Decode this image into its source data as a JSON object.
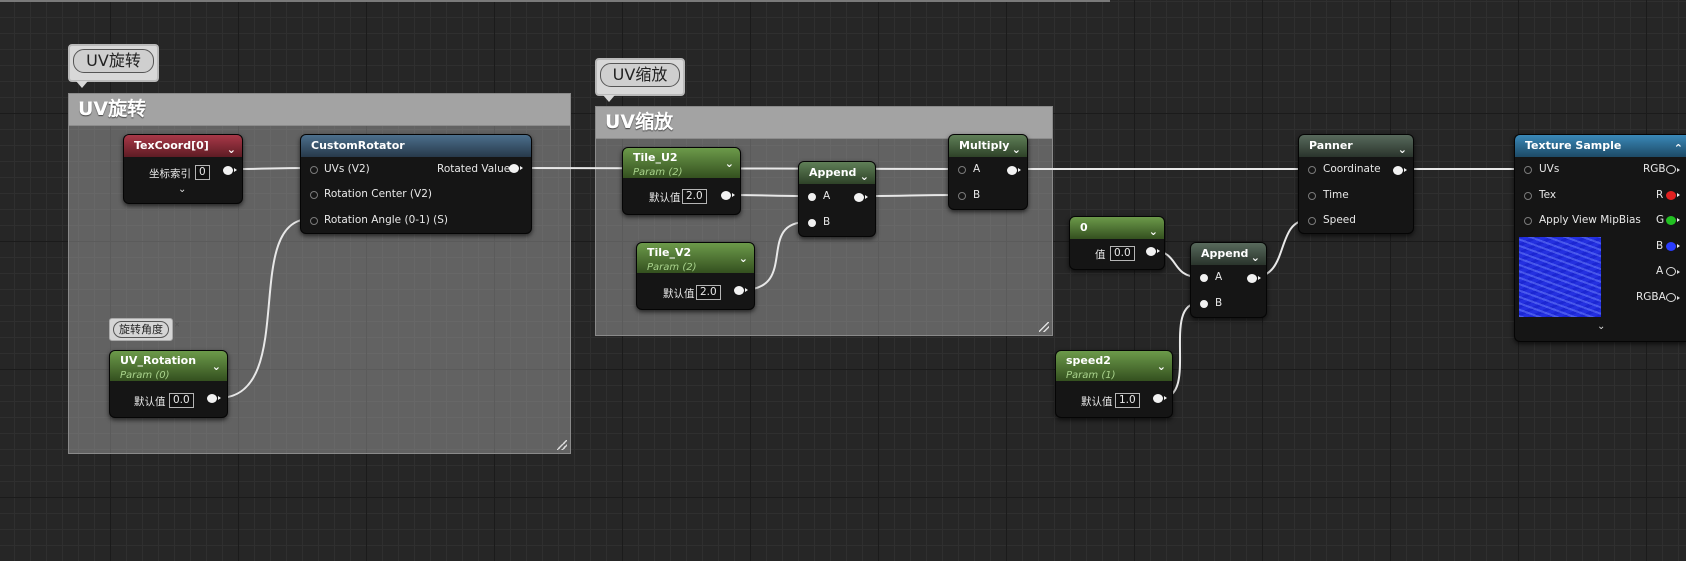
{
  "comments": {
    "rotate": {
      "title": "UV旋转",
      "bubble": "UV旋转"
    },
    "scale": {
      "title": "UV缩放",
      "bubble": "UV缩放"
    }
  },
  "nodes": {
    "texcoord": {
      "title": "TexCoord[0]",
      "row_label": "坐标索引",
      "value": "0"
    },
    "custom_rotator": {
      "title": "CustomRotator",
      "inputs": [
        "UVs (V2)",
        "Rotation Center (V2)",
        "Rotation Angle (0-1) (S)"
      ],
      "output": "Rotated Values"
    },
    "uv_rotation": {
      "title": "UV_Rotation",
      "subtitle": "Param (0)",
      "row_label": "默认值",
      "value": "0.0",
      "bubble": "旋转角度"
    },
    "tile_u2": {
      "title": "Tile_U2",
      "subtitle": "Param (2)",
      "row_label": "默认值",
      "value": "2.0"
    },
    "tile_v2": {
      "title": "Tile_V2",
      "subtitle": "Param (2)",
      "row_label": "默认值",
      "value": "2.0"
    },
    "append1": {
      "title": "Append",
      "inputs": [
        "A",
        "B"
      ]
    },
    "multiply": {
      "title": "Multiply",
      "inputs": [
        "A",
        "B"
      ]
    },
    "const0": {
      "title": "0",
      "row_label": "值",
      "value": "0.0"
    },
    "append2": {
      "title": "Append",
      "inputs": [
        "A",
        "B"
      ]
    },
    "speed2": {
      "title": "speed2",
      "subtitle": "Param (1)",
      "row_label": "默认值",
      "value": "1.0"
    },
    "panner": {
      "title": "Panner",
      "inputs": [
        "Coordinate",
        "Time",
        "Speed"
      ]
    },
    "texture_sample": {
      "title": "Texture Sample",
      "inputs": [
        "UVs",
        "Tex",
        "Apply View MipBias"
      ],
      "outputs": [
        "RGB",
        "R",
        "G",
        "B",
        "A",
        "RGBA"
      ]
    }
  },
  "colors": {
    "red_pin": "#e02020",
    "green_pin": "#22c022",
    "blue_pin": "#2a3cff"
  }
}
